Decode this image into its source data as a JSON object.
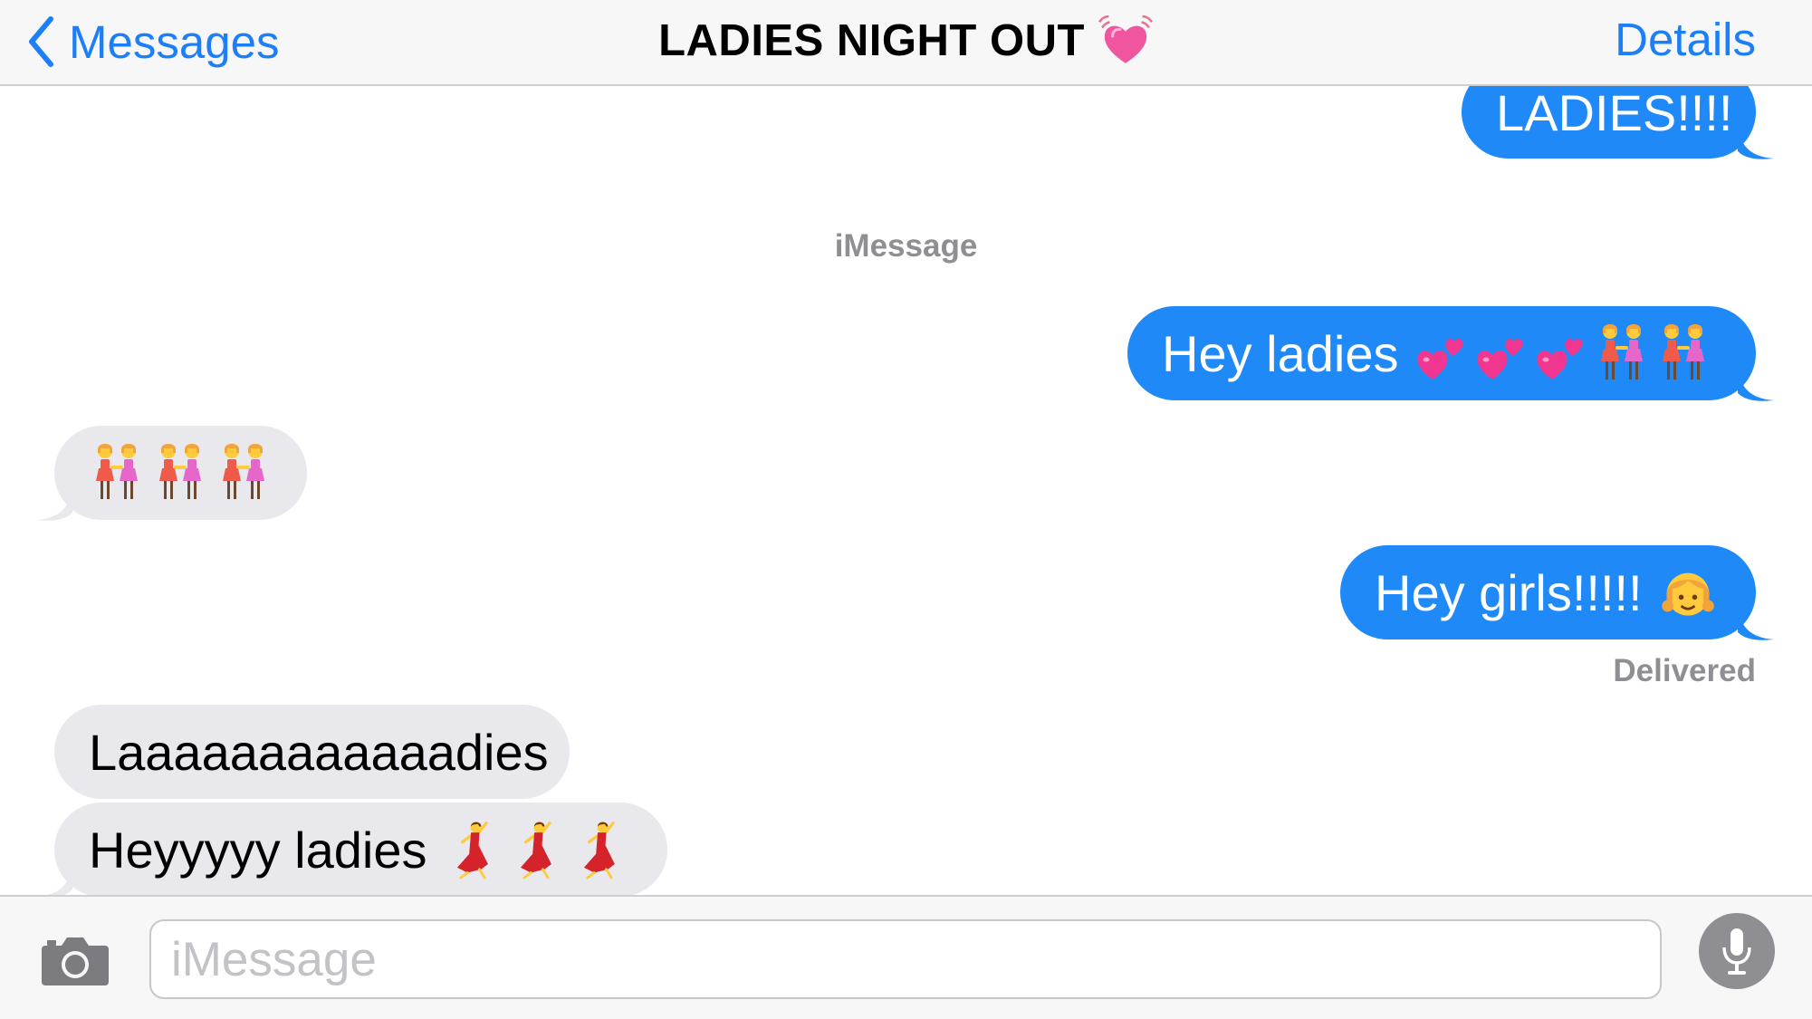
{
  "nav": {
    "back_label": "Messages",
    "title": "LADIES NIGHT OUT",
    "title_icon": "beating-heart-emoji",
    "details_label": "Details"
  },
  "messages": [
    {
      "direction": "outgoing",
      "text": "LADIES!!!!"
    },
    {
      "type": "service_label",
      "text": "iMessage"
    },
    {
      "direction": "outgoing",
      "text": "Hey ladies",
      "emoji": [
        "two-hearts",
        "two-hearts",
        "two-hearts",
        "two-women-holding-hands",
        "two-women-holding-hands"
      ]
    },
    {
      "direction": "incoming",
      "text": "",
      "emoji": [
        "two-women-holding-hands",
        "two-women-holding-hands",
        "two-women-holding-hands"
      ]
    },
    {
      "direction": "outgoing",
      "text": "Hey girls!!!!!",
      "emoji": [
        "girl"
      ]
    },
    {
      "type": "status",
      "text": "Delivered"
    },
    {
      "direction": "incoming",
      "text": "Laaaaaaaaaaaadies"
    },
    {
      "direction": "incoming",
      "text": "Heyyyyy ladies",
      "emoji": [
        "woman-dancing",
        "woman-dancing",
        "woman-dancing"
      ]
    }
  ],
  "composer": {
    "placeholder": "iMessage",
    "camera_icon": "camera-icon",
    "mic_icon": "microphone-icon"
  },
  "colors": {
    "accent": "#1d7ff7",
    "outgoing_bubble": "#1f8af7",
    "incoming_bubble": "#e8e8ed",
    "meta_text": "#8e8e93"
  }
}
